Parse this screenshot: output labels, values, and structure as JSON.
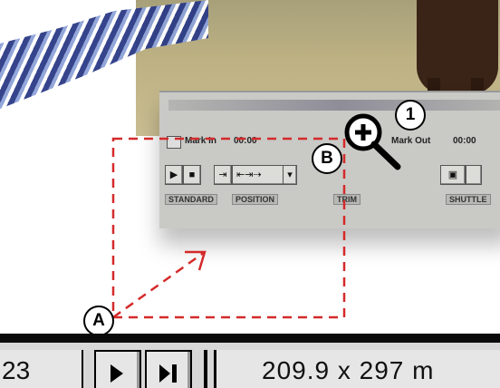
{
  "palette": {
    "mark_in_label": "Mark In",
    "mark_out_label": "Mark Out",
    "timecode_text": "00:00",
    "transport_icons": [
      "rewind-icon",
      "stop-icon",
      "step-icon",
      "step-double-icon",
      "mark-icon",
      "range-icon"
    ],
    "tab_labels": [
      "STANDARD",
      "POSITION",
      "TRIM",
      "SHUTTLE"
    ]
  },
  "callouts": {
    "one": "1",
    "a": "A",
    "b": "B"
  },
  "toolbar": {
    "frame_field": "23",
    "play_icon": "play-icon",
    "step_icon": "step-forward-icon",
    "size_text": "209.9 x 297  m"
  },
  "colors": {
    "dashed_outline": "#d42a2a",
    "arrow": "#d42a2a",
    "toolbar_bg": "#d7d7d7",
    "black_bar": "#0a0a0a"
  }
}
